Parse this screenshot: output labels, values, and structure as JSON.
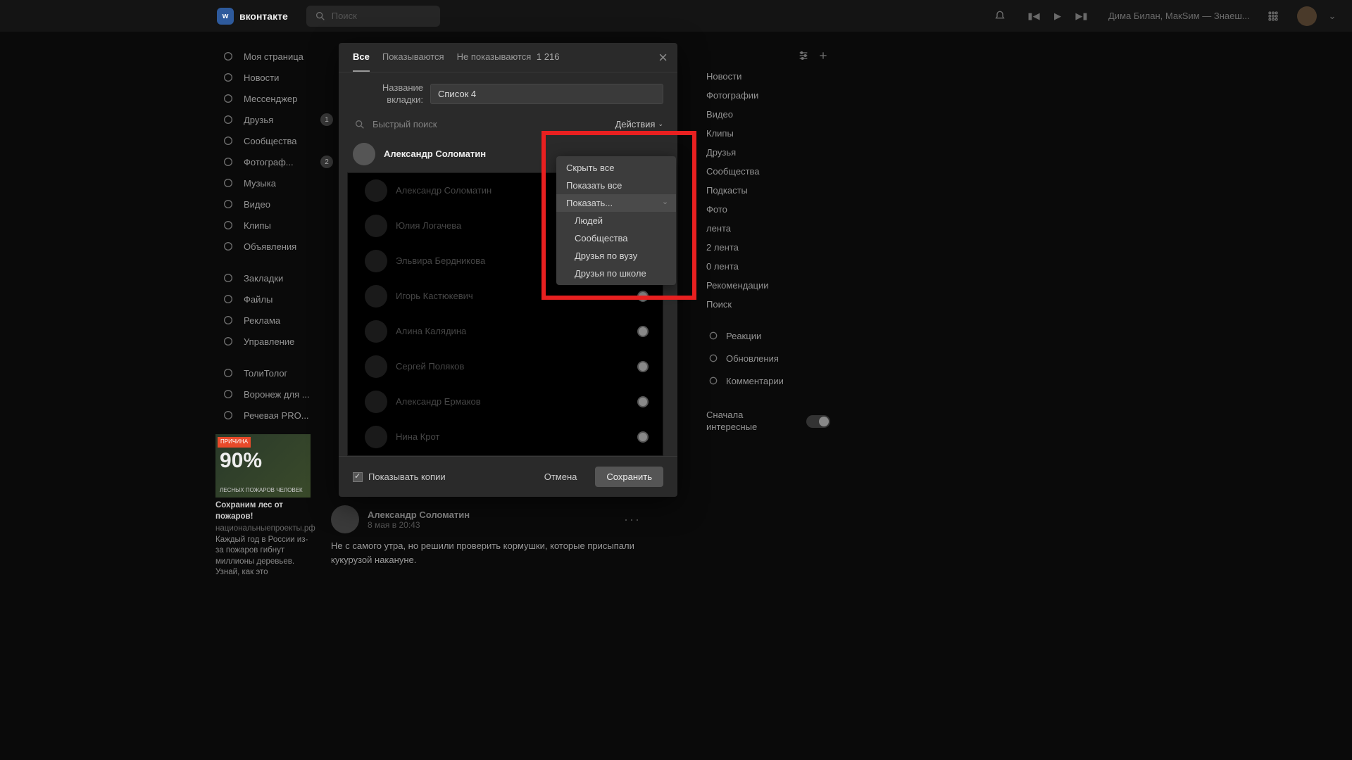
{
  "header": {
    "brand": "вконтакте",
    "logo_letter": "w",
    "search_placeholder": "Поиск",
    "track": "Дима Билан, МакSим — Знаеш..."
  },
  "nav": [
    {
      "label": "Моя страница",
      "badge": ""
    },
    {
      "label": "Новости",
      "badge": ""
    },
    {
      "label": "Мессенджер",
      "badge": ""
    },
    {
      "label": "Друзья",
      "badge": "1"
    },
    {
      "label": "Сообщества",
      "badge": ""
    },
    {
      "label": "Фотограф...",
      "badge": "2"
    },
    {
      "label": "Музыка",
      "badge": ""
    },
    {
      "label": "Видео",
      "badge": ""
    },
    {
      "label": "Клипы",
      "badge": ""
    },
    {
      "label": "Объявления",
      "badge": ""
    }
  ],
  "nav2": [
    {
      "label": "Закладки"
    },
    {
      "label": "Файлы"
    },
    {
      "label": "Реклама"
    },
    {
      "label": "Управление"
    }
  ],
  "nav3": [
    {
      "label": "ТолиТолог"
    },
    {
      "label": "Воронеж для ..."
    },
    {
      "label": "Речевая PRO..."
    }
  ],
  "promo": {
    "tag": "ПРИЧИНА",
    "big": "90%",
    "img_txt": "ЛЕСНЫХ ПОЖАРОВ ЧЕЛОВЕК",
    "title": "Сохраним лес от пожаров!",
    "sub": "национальныепроекты.рф",
    "body": "Каждый год в России из-за пожаров гибнут миллионы деревьев. Узнай, как это"
  },
  "right": {
    "items": [
      "Новости",
      "Фотографии",
      "Видео",
      "Клипы",
      "Друзья",
      "Сообщества",
      "Подкасты",
      "Фото",
      "лента",
      "2 лента",
      "0 лента",
      "Рекомендации",
      "Поиск"
    ],
    "items2": [
      "Реакции",
      "Обновления",
      "Комментарии"
    ],
    "toggle": "Сначала интересные"
  },
  "modal": {
    "tabs": {
      "all": "Все",
      "shown": "Показываются",
      "hidden": "Не показываются",
      "count": "1 216"
    },
    "name_label": "Название вкладки:",
    "name_value": "Список 4",
    "quick_placeholder": "Быстрый поиск",
    "actions": "Действия",
    "pinned_user": "Александр Соломатин",
    "list": [
      "Александр Соломатин",
      "Юлия Логачева",
      "Эльвира Бердникова",
      "Игорь Кастюкевич",
      "Алина Калядина",
      "Сергей Поляков",
      "Александр Ермаков",
      "Нина Крот"
    ],
    "show_copies": "Показывать копии",
    "cancel": "Отмена",
    "save": "Сохранить"
  },
  "dropdown": {
    "items": [
      "Скрыть все",
      "Показать все",
      "Показать...",
      "Людей",
      "Сообщества",
      "Друзья по вузу",
      "Друзья по школе"
    ]
  },
  "post": {
    "author": "Александр Соломатин",
    "time": "8 мая в 20:43",
    "body": "Не с самого утра, но решили проверить кормушки, которые присыпали кукурузой накануне."
  }
}
